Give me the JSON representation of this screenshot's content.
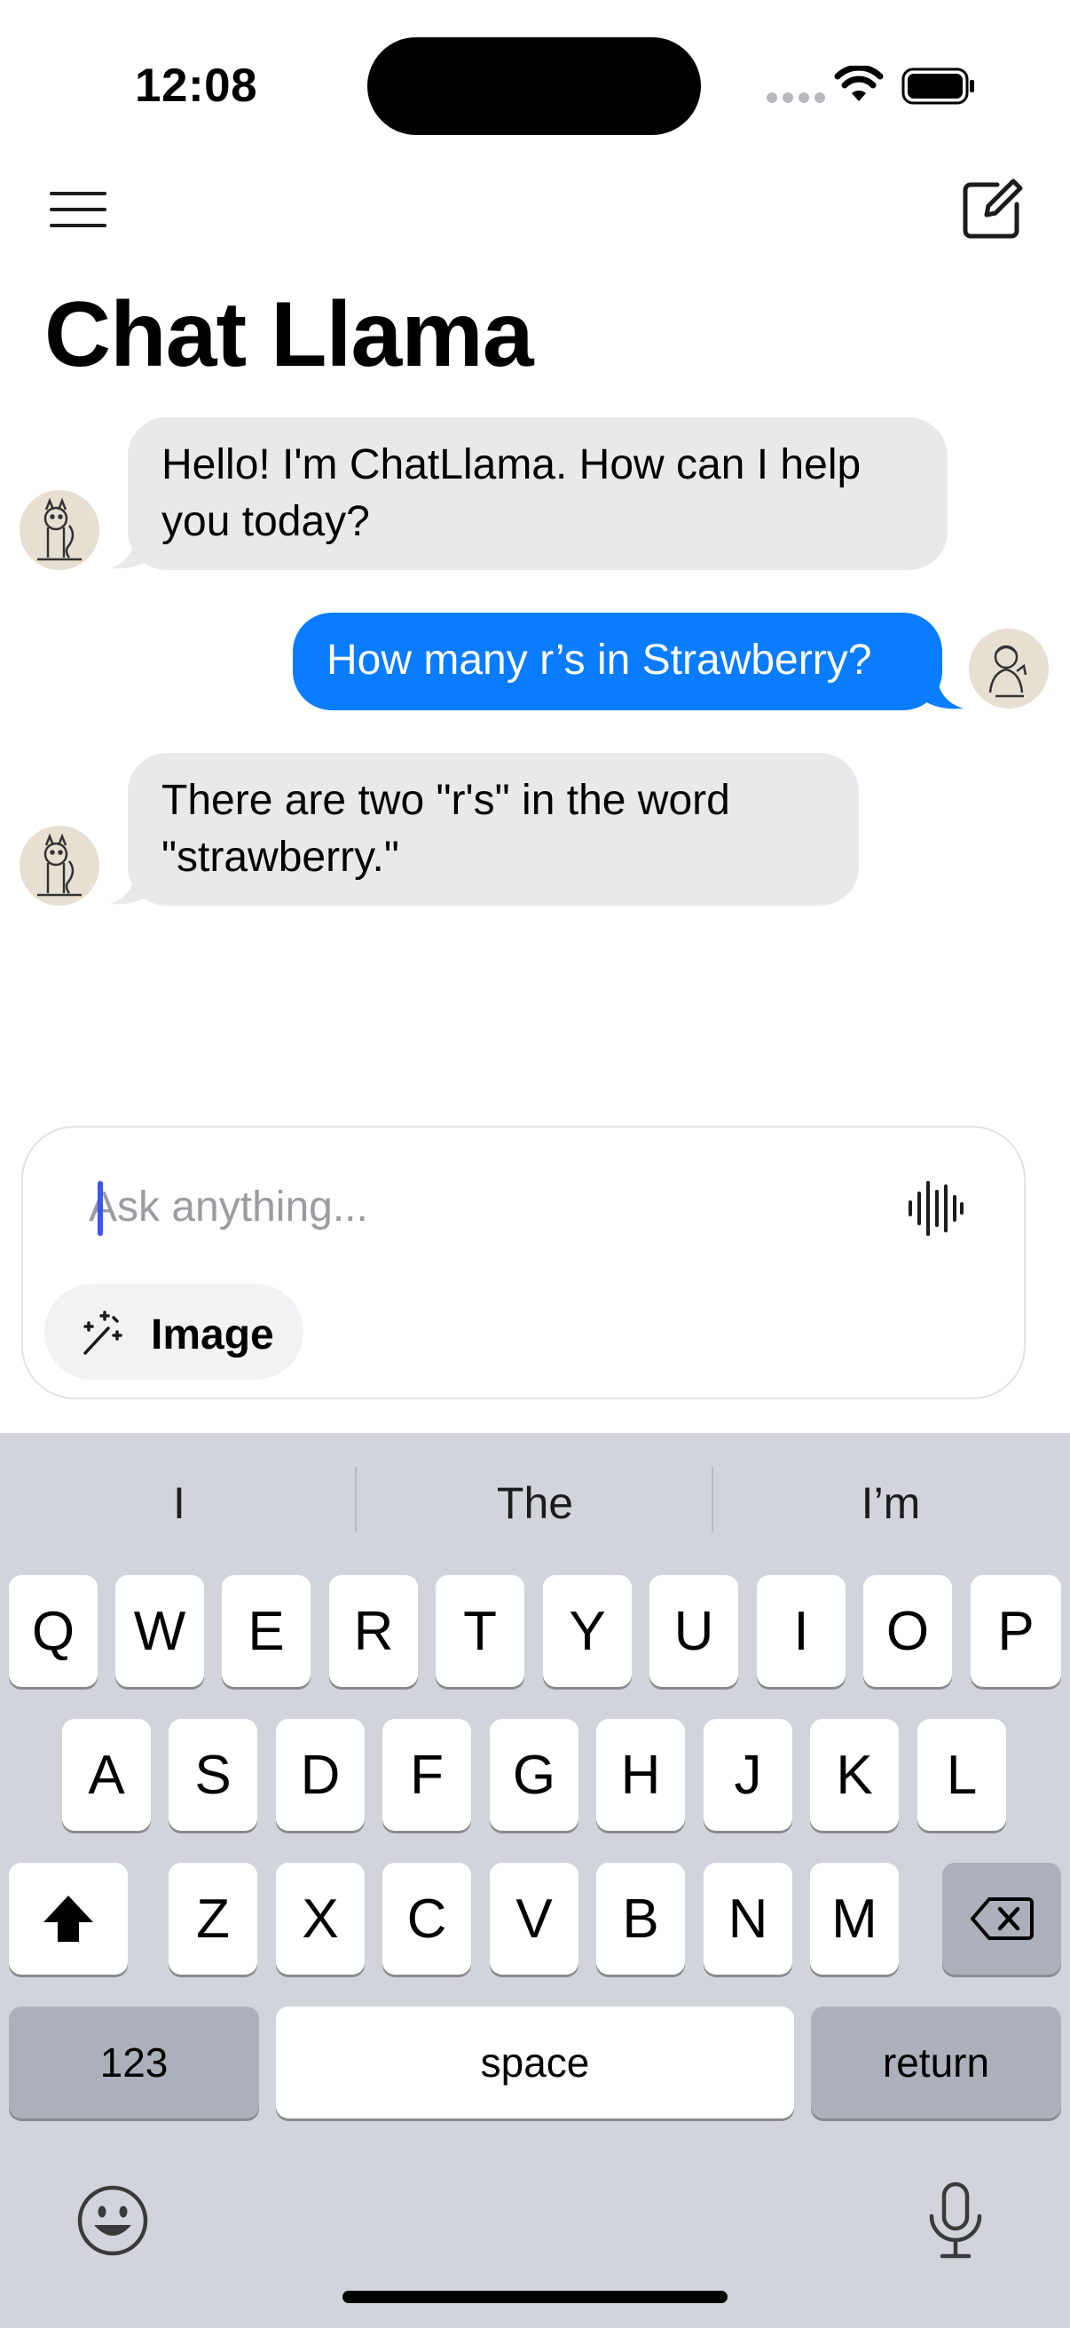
{
  "status_bar": {
    "time": "12:08"
  },
  "header": {
    "title": "Chat Llama"
  },
  "messages": [
    {
      "role": "assistant",
      "line1": "Hello! I'm ChatLlama. How can I help",
      "line2": "you today?"
    },
    {
      "role": "user",
      "line1": "How many r’s in Strawberry?"
    },
    {
      "role": "assistant",
      "line1": "There are two \"r's\" in the word",
      "line2": "\"strawberry.\""
    }
  ],
  "composer": {
    "placeholder": "Ask anything...",
    "image_button_label": "Image"
  },
  "keyboard": {
    "suggestions": [
      "I",
      "The",
      "I’m"
    ],
    "row1": [
      "Q",
      "W",
      "E",
      "R",
      "T",
      "Y",
      "U",
      "I",
      "O",
      "P"
    ],
    "row2": [
      "A",
      "S",
      "D",
      "F",
      "G",
      "H",
      "J",
      "K",
      "L"
    ],
    "row3": [
      "Z",
      "X",
      "C",
      "V",
      "B",
      "N",
      "M"
    ],
    "numbers_label": "123",
    "space_label": "space",
    "return_label": "return"
  },
  "colors": {
    "user_bubble": "#0a7cff",
    "assistant_bubble": "#e9e9eb",
    "keyboard_bg": "#d1d4db",
    "caret": "#3c55f5"
  },
  "icons": [
    "menu-icon",
    "compose-icon",
    "wifi-icon",
    "battery-icon",
    "voice-waveform-icon",
    "magic-wand-icon",
    "shift-icon",
    "backspace-icon",
    "emoji-icon",
    "microphone-icon"
  ]
}
